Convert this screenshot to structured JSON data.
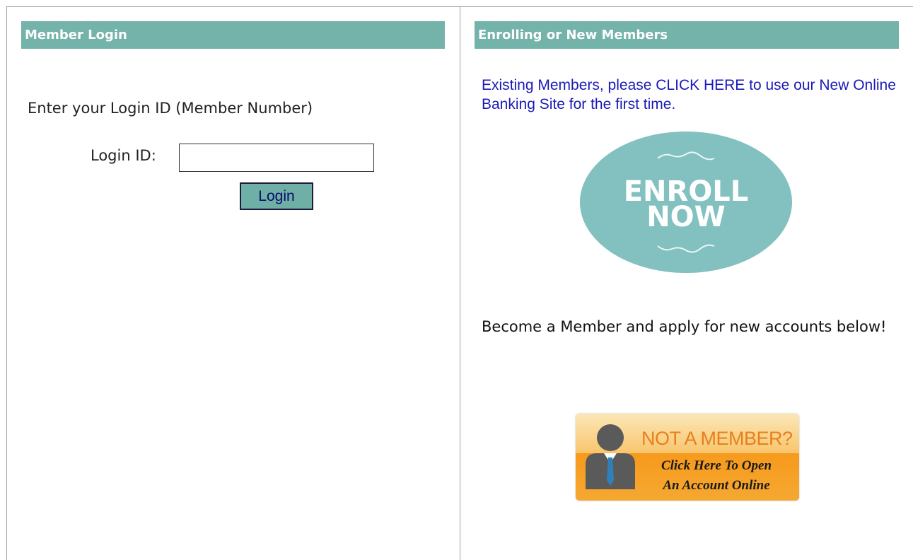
{
  "left_panel": {
    "header": "Member Login",
    "instruction": "Enter your Login ID (Member Number)",
    "login_label": "Login ID:",
    "login_value": "",
    "login_button": "Login"
  },
  "right_panel": {
    "header": "Enrolling or New Members",
    "existing_link": "Existing Members, please CLICK HERE to use our New Online Banking Site for the first time.",
    "enroll_line1": "ENROLL",
    "enroll_line2": "NOW",
    "become_text": "Become a Member and apply for new accounts below!",
    "member_button": {
      "title": "NOT A MEMBER?",
      "subtitle_line1": "Click Here To Open",
      "subtitle_line2": "An Account Online",
      "icon": "person-icon"
    }
  },
  "colors": {
    "header_bg": "#74b3aa",
    "link": "#1a1ab8",
    "enroll_circle": "#83c0c0",
    "member_orange": "#f79a1c"
  }
}
